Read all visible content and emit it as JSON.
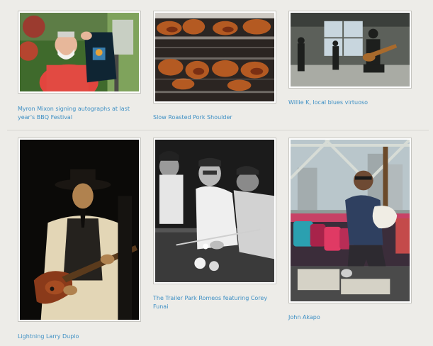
{
  "gallery": {
    "photos": [
      {
        "caption": "Myron Mixon signing autographs at last year's BBQ Festival",
        "scene": "man-holding-shirt-icon"
      },
      {
        "caption": "Slow Roasted Pork Shoulder",
        "scene": "roasted-pork-grill-icon"
      },
      {
        "caption": "Willie K, local blues virtuoso",
        "scene": "band-on-rooftop-icon"
      },
      {
        "caption": "Lightning Larry Dupio",
        "scene": "guitarist-in-hat-icon"
      },
      {
        "caption": "The Trailer Park Romeos featuring Corey Funai",
        "scene": "pool-table-trio-icon"
      },
      {
        "caption": "John Akapo",
        "scene": "guitarist-on-couch-icon"
      }
    ]
  }
}
